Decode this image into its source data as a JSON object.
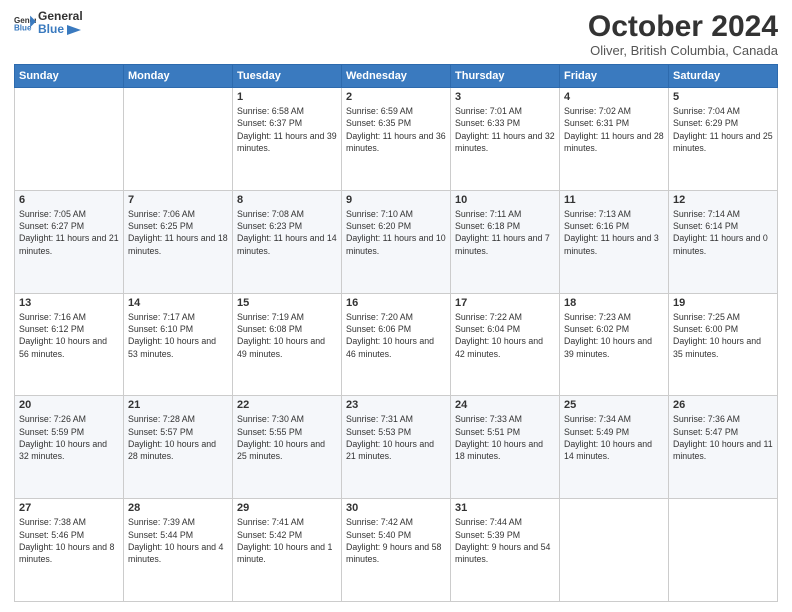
{
  "header": {
    "logo_line1": "General",
    "logo_line2": "Blue",
    "title": "October 2024",
    "subtitle": "Oliver, British Columbia, Canada"
  },
  "columns": [
    "Sunday",
    "Monday",
    "Tuesday",
    "Wednesday",
    "Thursday",
    "Friday",
    "Saturday"
  ],
  "weeks": [
    [
      {
        "day": "",
        "info": ""
      },
      {
        "day": "",
        "info": ""
      },
      {
        "day": "1",
        "info": "Sunrise: 6:58 AM\nSunset: 6:37 PM\nDaylight: 11 hours and 39 minutes."
      },
      {
        "day": "2",
        "info": "Sunrise: 6:59 AM\nSunset: 6:35 PM\nDaylight: 11 hours and 36 minutes."
      },
      {
        "day": "3",
        "info": "Sunrise: 7:01 AM\nSunset: 6:33 PM\nDaylight: 11 hours and 32 minutes."
      },
      {
        "day": "4",
        "info": "Sunrise: 7:02 AM\nSunset: 6:31 PM\nDaylight: 11 hours and 28 minutes."
      },
      {
        "day": "5",
        "info": "Sunrise: 7:04 AM\nSunset: 6:29 PM\nDaylight: 11 hours and 25 minutes."
      }
    ],
    [
      {
        "day": "6",
        "info": "Sunrise: 7:05 AM\nSunset: 6:27 PM\nDaylight: 11 hours and 21 minutes."
      },
      {
        "day": "7",
        "info": "Sunrise: 7:06 AM\nSunset: 6:25 PM\nDaylight: 11 hours and 18 minutes."
      },
      {
        "day": "8",
        "info": "Sunrise: 7:08 AM\nSunset: 6:23 PM\nDaylight: 11 hours and 14 minutes."
      },
      {
        "day": "9",
        "info": "Sunrise: 7:10 AM\nSunset: 6:20 PM\nDaylight: 11 hours and 10 minutes."
      },
      {
        "day": "10",
        "info": "Sunrise: 7:11 AM\nSunset: 6:18 PM\nDaylight: 11 hours and 7 minutes."
      },
      {
        "day": "11",
        "info": "Sunrise: 7:13 AM\nSunset: 6:16 PM\nDaylight: 11 hours and 3 minutes."
      },
      {
        "day": "12",
        "info": "Sunrise: 7:14 AM\nSunset: 6:14 PM\nDaylight: 11 hours and 0 minutes."
      }
    ],
    [
      {
        "day": "13",
        "info": "Sunrise: 7:16 AM\nSunset: 6:12 PM\nDaylight: 10 hours and 56 minutes."
      },
      {
        "day": "14",
        "info": "Sunrise: 7:17 AM\nSunset: 6:10 PM\nDaylight: 10 hours and 53 minutes."
      },
      {
        "day": "15",
        "info": "Sunrise: 7:19 AM\nSunset: 6:08 PM\nDaylight: 10 hours and 49 minutes."
      },
      {
        "day": "16",
        "info": "Sunrise: 7:20 AM\nSunset: 6:06 PM\nDaylight: 10 hours and 46 minutes."
      },
      {
        "day": "17",
        "info": "Sunrise: 7:22 AM\nSunset: 6:04 PM\nDaylight: 10 hours and 42 minutes."
      },
      {
        "day": "18",
        "info": "Sunrise: 7:23 AM\nSunset: 6:02 PM\nDaylight: 10 hours and 39 minutes."
      },
      {
        "day": "19",
        "info": "Sunrise: 7:25 AM\nSunset: 6:00 PM\nDaylight: 10 hours and 35 minutes."
      }
    ],
    [
      {
        "day": "20",
        "info": "Sunrise: 7:26 AM\nSunset: 5:59 PM\nDaylight: 10 hours and 32 minutes."
      },
      {
        "day": "21",
        "info": "Sunrise: 7:28 AM\nSunset: 5:57 PM\nDaylight: 10 hours and 28 minutes."
      },
      {
        "day": "22",
        "info": "Sunrise: 7:30 AM\nSunset: 5:55 PM\nDaylight: 10 hours and 25 minutes."
      },
      {
        "day": "23",
        "info": "Sunrise: 7:31 AM\nSunset: 5:53 PM\nDaylight: 10 hours and 21 minutes."
      },
      {
        "day": "24",
        "info": "Sunrise: 7:33 AM\nSunset: 5:51 PM\nDaylight: 10 hours and 18 minutes."
      },
      {
        "day": "25",
        "info": "Sunrise: 7:34 AM\nSunset: 5:49 PM\nDaylight: 10 hours and 14 minutes."
      },
      {
        "day": "26",
        "info": "Sunrise: 7:36 AM\nSunset: 5:47 PM\nDaylight: 10 hours and 11 minutes."
      }
    ],
    [
      {
        "day": "27",
        "info": "Sunrise: 7:38 AM\nSunset: 5:46 PM\nDaylight: 10 hours and 8 minutes."
      },
      {
        "day": "28",
        "info": "Sunrise: 7:39 AM\nSunset: 5:44 PM\nDaylight: 10 hours and 4 minutes."
      },
      {
        "day": "29",
        "info": "Sunrise: 7:41 AM\nSunset: 5:42 PM\nDaylight: 10 hours and 1 minute."
      },
      {
        "day": "30",
        "info": "Sunrise: 7:42 AM\nSunset: 5:40 PM\nDaylight: 9 hours and 58 minutes."
      },
      {
        "day": "31",
        "info": "Sunrise: 7:44 AM\nSunset: 5:39 PM\nDaylight: 9 hours and 54 minutes."
      },
      {
        "day": "",
        "info": ""
      },
      {
        "day": "",
        "info": ""
      }
    ]
  ]
}
